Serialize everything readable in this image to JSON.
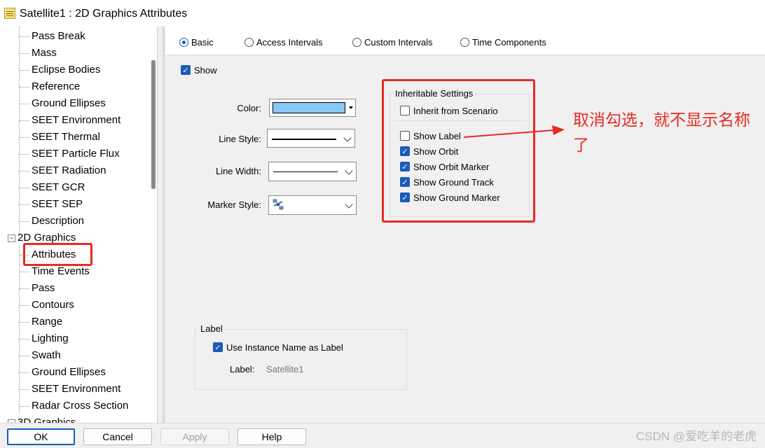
{
  "window": {
    "title": "Satellite1 : 2D Graphics Attributes"
  },
  "tree": {
    "items_top": [
      "Pass Break",
      "Mass",
      "Eclipse Bodies",
      "Reference",
      "Ground Ellipses",
      "SEET Environment",
      "SEET Thermal",
      "SEET Particle Flux",
      "SEET Radiation",
      "SEET GCR",
      "SEET SEP",
      "Description"
    ],
    "category_2d": "2D Graphics",
    "category_2d_toggle": "−",
    "items_2d": [
      "Attributes",
      "Time Events",
      "Pass",
      "Contours",
      "Range",
      "Lighting",
      "Swath",
      "Ground Ellipses",
      "SEET Environment",
      "Radar Cross Section"
    ],
    "category_3d": "3D Graphics",
    "category_3d_toggle": "−",
    "selected": "Attributes"
  },
  "tabs": [
    "Basic",
    "Access Intervals",
    "Custom Intervals",
    "Time Components"
  ],
  "tabs_selected": 0,
  "basic": {
    "show_label": "Show",
    "show_checked": true,
    "color_label": "Color:",
    "color_value": "#87c8f5",
    "line_style_label": "Line Style:",
    "line_width_label": "Line Width:",
    "marker_style_label": "Marker Style:"
  },
  "inheritable": {
    "title": "Inheritable Settings",
    "inherit": {
      "label": "Inherit from Scenario",
      "checked": false
    },
    "options": [
      {
        "label": "Show Label",
        "checked": false
      },
      {
        "label": "Show Orbit",
        "checked": true
      },
      {
        "label": "Show Orbit Marker",
        "checked": true
      },
      {
        "label": "Show Ground Track",
        "checked": true
      },
      {
        "label": "Show Ground Marker",
        "checked": true
      }
    ]
  },
  "label_group": {
    "title": "Label",
    "use_instance": {
      "label": "Use Instance Name as Label",
      "checked": true
    },
    "label_caption": "Label:",
    "label_value": "Satellite1"
  },
  "annotation": {
    "text": "取消勾选，就不显示名称了",
    "color": "#e62b24"
  },
  "buttons": {
    "ok": "OK",
    "cancel": "Cancel",
    "apply": "Apply",
    "help": "Help"
  },
  "watermark": "CSDN @爱吃羊的老虎"
}
